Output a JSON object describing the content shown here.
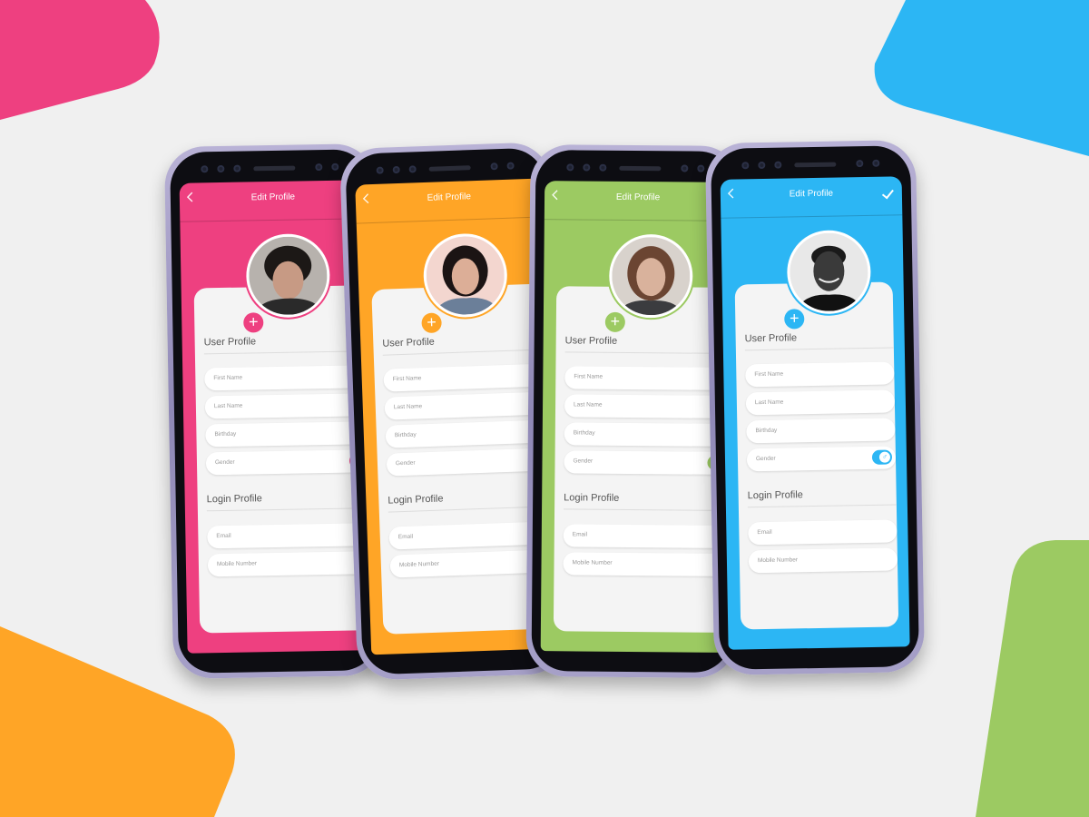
{
  "colors": {
    "pink": "#ee4080",
    "orange": "#ffa526",
    "green": "#9cca62",
    "blue": "#2cb6f4"
  },
  "phones": [
    {
      "title": "Edit Profile",
      "user_profile": "User Profile",
      "login_profile": "Login Profile",
      "first_name": "First Name",
      "last_name": "Last Name",
      "birthday": "Birthday",
      "gender": "Gender",
      "email": "Email",
      "mobile": "Mobile Number",
      "gender_icon": "♀"
    },
    {
      "title": "Edit Profile",
      "user_profile": "User Profile",
      "login_profile": "Login Profile",
      "first_name": "First Name",
      "last_name": "Last Name",
      "birthday": "Birthday",
      "gender": "Gender",
      "email": "Email",
      "mobile": "Mobile Number",
      "gender_icon": "♀"
    },
    {
      "title": "Edit Profile",
      "user_profile": "User Profile",
      "login_profile": "Login Profile",
      "first_name": "First Name",
      "last_name": "Last Name",
      "birthday": "Birthday",
      "gender": "Gender",
      "email": "Email",
      "mobile": "Mobile Number",
      "gender_icon": "♀"
    },
    {
      "title": "Edit Profile",
      "user_profile": "User Profile",
      "login_profile": "Login Profile",
      "first_name": "First Name",
      "last_name": "Last Name",
      "birthday": "Birthday",
      "gender": "Gender",
      "email": "Email",
      "mobile": "Mobile Number",
      "gender_icon": "♂"
    }
  ]
}
